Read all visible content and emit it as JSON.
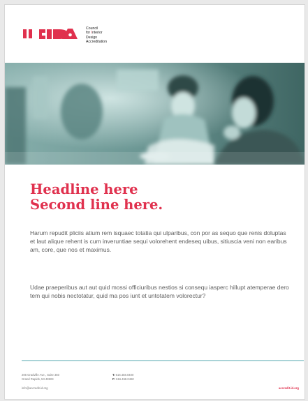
{
  "brand": {
    "logo_text": "CIDA",
    "line1": "Council",
    "line2_prefix": "for ",
    "line2_hl": "I",
    "line2_rest": "nterior",
    "line3": "Design",
    "line4": "Accreditation",
    "accent_color": "#e0314e",
    "rule_color": "#a9d3d7",
    "photo_tint": "#6f9b98"
  },
  "content": {
    "headline_line1": "Headline here",
    "headline_line2": "Second line here.",
    "paragraph1": "Harum repudit pliciis atium rem isquaec totatia qui ulparibus, con por as sequo que renis doluptas et laut alique rehent is cum inveruntiae sequi volorehent endeseq uibus, sitiuscia veni non earibus am, core, que nos et maximus.",
    "paragraph2": "Udae praeperibus aut aut quid mossi officiuribus nestios si consequ iasperc hillupt atemperae dero tem qui nobis nectotatur, quid ma pos iunt et untotatem volorectur?"
  },
  "footer": {
    "address_line1": "206 Gradville Ave., Suite 350",
    "address_line2": "Grand Rapids, MI 49503",
    "phone_label": "T:",
    "phone": "616.458.0400",
    "fax_label": "F:",
    "fax": "616.458.0460",
    "email": "info@accredit-id.org",
    "website": "accredit-id.org"
  }
}
